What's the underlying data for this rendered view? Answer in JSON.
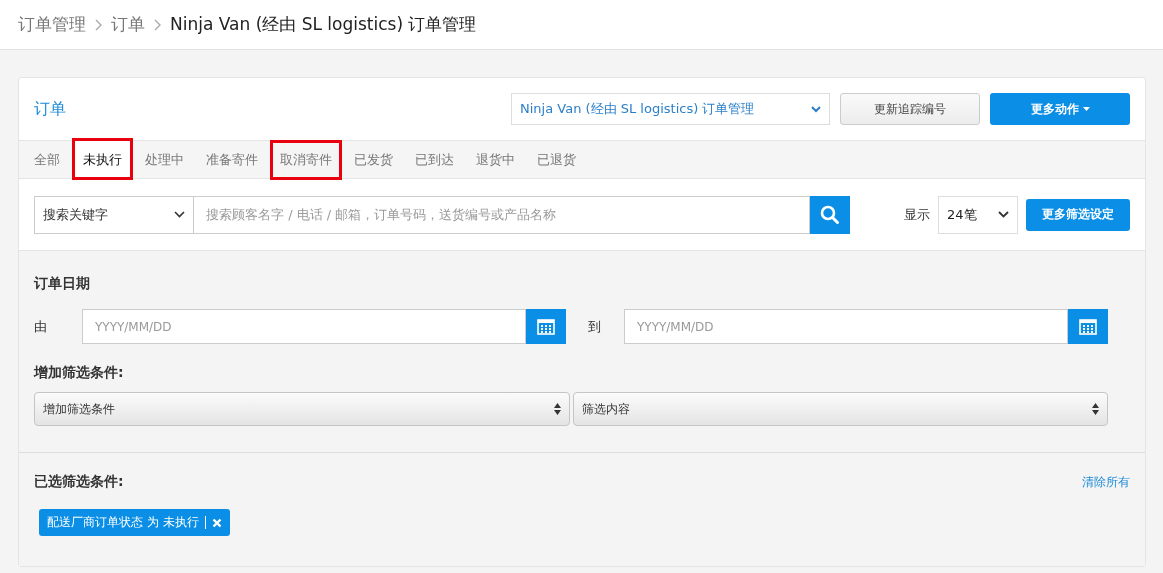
{
  "breadcrumb": [
    {
      "label": "订单管理",
      "current": false
    },
    {
      "label": "订单",
      "current": false
    },
    {
      "label": "Ninja Van (经由 SL logistics) 订单管理",
      "current": true
    }
  ],
  "card": {
    "title": "订单",
    "channel_select": "Ninja Van (经由 SL logistics) 订单管理",
    "update_button": "更新追踪编号",
    "more_actions_button": "更多动作"
  },
  "tabs": [
    {
      "label": "全部",
      "selected": false,
      "highlighted": false
    },
    {
      "label": "未执行",
      "selected": true,
      "highlighted": true
    },
    {
      "label": "处理中",
      "selected": false,
      "highlighted": false
    },
    {
      "label": "准备寄件",
      "selected": false,
      "highlighted": false
    },
    {
      "label": "取消寄件",
      "selected": false,
      "highlighted": true
    },
    {
      "label": "已发货",
      "selected": false,
      "highlighted": false
    },
    {
      "label": "已到达",
      "selected": false,
      "highlighted": false
    },
    {
      "label": "退货中",
      "selected": false,
      "highlighted": false
    },
    {
      "label": "已退货",
      "selected": false,
      "highlighted": false
    }
  ],
  "search": {
    "type_select": "搜索关键字",
    "placeholder": "搜索顾客名字 / 电话 / 邮箱，订单号码，送货编号或产品名称",
    "show_label": "显示",
    "per_page": "24笔",
    "more_filters_button": "更多筛选设定"
  },
  "filters": {
    "date_title": "订单日期",
    "from_label": "由",
    "from_placeholder": "YYYY/MM/DD",
    "to_label": "到",
    "to_placeholder": "YYYY/MM/DD",
    "add_title": "增加筛选条件:",
    "add_select": "增加筛选条件",
    "content_select": "筛选内容"
  },
  "selected_filters": {
    "title": "已选筛选条件:",
    "clear_all": "清除所有",
    "tags": [
      {
        "label": "配送厂商订单状态 为 未执行"
      }
    ]
  }
}
